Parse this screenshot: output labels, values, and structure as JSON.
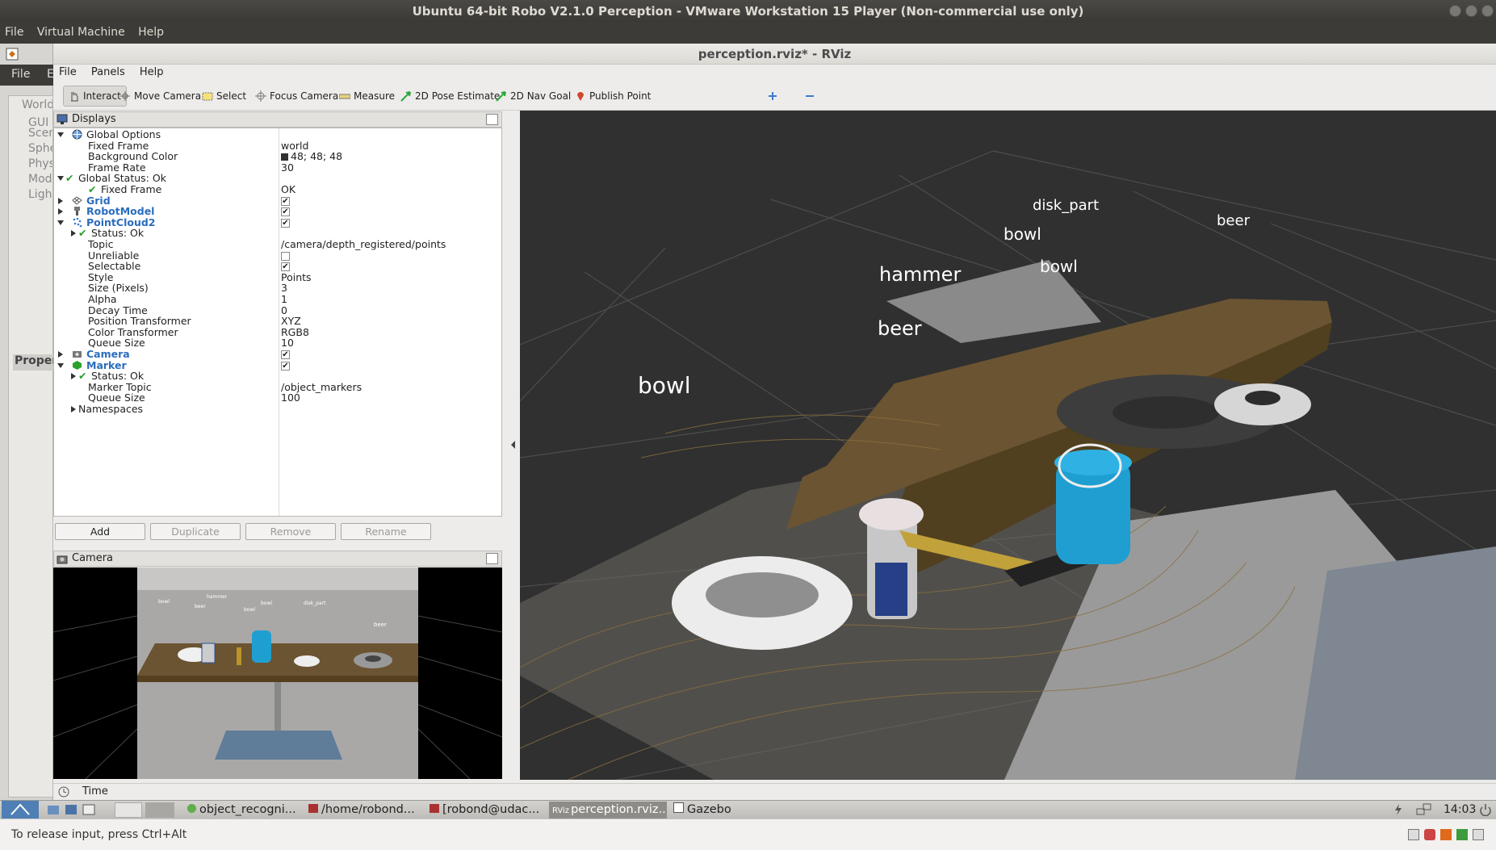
{
  "vm": {
    "title": "Ubuntu 64-bit Robo V2.1.0 Perception - VMware Workstation 15 Player (Non-commercial use only)",
    "menu": [
      "File",
      "Virtual Machine",
      "Help"
    ],
    "status": "To release input, press Ctrl+Alt"
  },
  "gazebo": {
    "menu": [
      "File",
      "E"
    ],
    "tab": "World",
    "tree": [
      "GUI",
      "Scene",
      "Sphe",
      "Phys",
      "Mod",
      "Ligh"
    ],
    "properties_label": "Proper"
  },
  "rviz": {
    "title": "perception.rviz* - RViz",
    "menu": [
      "File",
      "Panels",
      "Help"
    ],
    "toolbar": [
      "Interact",
      "Move Camera",
      "Select",
      "Focus Camera",
      "Measure",
      "2D Pose Estimate",
      "2D Nav Goal",
      "Publish Point"
    ],
    "displays_title": "Displays",
    "camera_title": "Camera",
    "time_label": "Time",
    "buttons": [
      "Add",
      "Duplicate",
      "Remove",
      "Rename"
    ],
    "tree": [
      {
        "k": "Global Options",
        "v": ""
      },
      {
        "k": "Fixed Frame",
        "v": "world"
      },
      {
        "k": "Background Color",
        "v": "48; 48; 48"
      },
      {
        "k": "Frame Rate",
        "v": "30"
      },
      {
        "k": "Global Status: Ok",
        "v": ""
      },
      {
        "k": "Fixed Frame",
        "v": "OK"
      },
      {
        "k": "Grid",
        "v": ""
      },
      {
        "k": "RobotModel",
        "v": ""
      },
      {
        "k": "PointCloud2",
        "v": ""
      },
      {
        "k": "Status: Ok",
        "v": ""
      },
      {
        "k": "Topic",
        "v": "/camera/depth_registered/points"
      },
      {
        "k": "Unreliable",
        "v": ""
      },
      {
        "k": "Selectable",
        "v": ""
      },
      {
        "k": "Style",
        "v": "Points"
      },
      {
        "k": "Size (Pixels)",
        "v": "3"
      },
      {
        "k": "Alpha",
        "v": "1"
      },
      {
        "k": "Decay Time",
        "v": "0"
      },
      {
        "k": "Position Transformer",
        "v": "XYZ"
      },
      {
        "k": "Color Transformer",
        "v": "RGB8"
      },
      {
        "k": "Queue Size",
        "v": "10"
      },
      {
        "k": "Camera",
        "v": ""
      },
      {
        "k": "Marker",
        "v": ""
      },
      {
        "k": "Status: Ok",
        "v": ""
      },
      {
        "k": "Marker Topic",
        "v": "/object_markers"
      },
      {
        "k": "Queue Size",
        "v": "100"
      },
      {
        "k": "Namespaces",
        "v": ""
      }
    ],
    "scene_labels": [
      "disk_part",
      "beer",
      "bowl",
      "bowl",
      "hammer",
      "beer",
      "bowl"
    ],
    "camera_labels": [
      "bowl",
      "hammer",
      "beer",
      "bowl",
      "bowl",
      "disk_part",
      "beer"
    ]
  },
  "taskbar": {
    "items": [
      "object_recogni...",
      "/home/robond...",
      "[robond@udac...",
      "perception.rviz...",
      "Gazebo"
    ],
    "clock": "14:03"
  },
  "colors": {
    "viewport_bg": "#303030",
    "accent_blue": "#2a6dbe",
    "status_green": "#2b9e2b"
  }
}
